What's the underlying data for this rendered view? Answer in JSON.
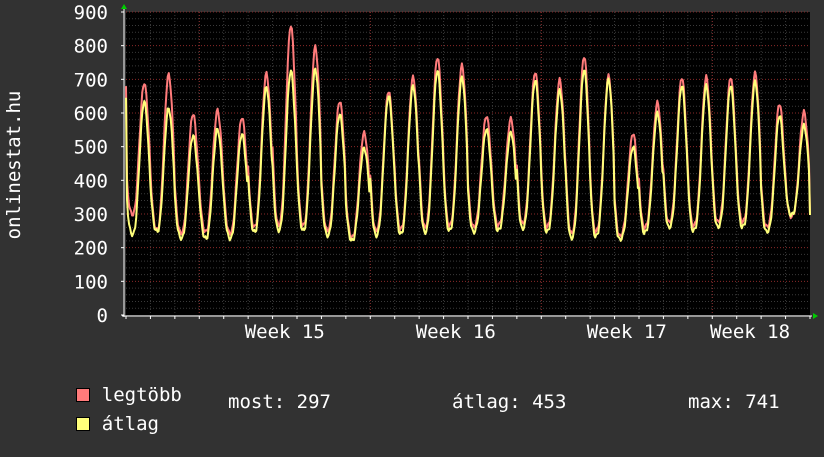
{
  "chart_data": {
    "type": "line",
    "ylabel": "onlinestat.hu",
    "ylim": [
      0,
      900
    ],
    "yticks": [
      0,
      100,
      200,
      300,
      400,
      500,
      600,
      700,
      800,
      900
    ],
    "xticks": [
      "Week 15",
      "Week 16",
      "Week 17",
      "Week 18"
    ],
    "grid": true,
    "days": 28,
    "series": [
      {
        "name": "legtöbb",
        "color": "#ff7b7b",
        "daily_peaks": [
          690,
          715,
          600,
          610,
          590,
          720,
          865,
          800,
          640,
          545,
          670,
          710,
          770,
          745,
          595,
          585,
          725,
          700,
          770,
          710,
          540,
          630,
          705,
          705,
          705,
          715,
          625,
          600
        ],
        "daily_lows": [
          300,
          255,
          245,
          250,
          245,
          265,
          270,
          270,
          255,
          235,
          255,
          260,
          265,
          270,
          265,
          270,
          275,
          265,
          245,
          250,
          235,
          260,
          275,
          265,
          275,
          275,
          260,
          290
        ]
      },
      {
        "name": "átlag",
        "color": "#ffff7b",
        "daily_peaks": [
          635,
          615,
          535,
          555,
          540,
          680,
          730,
          735,
          600,
          500,
          655,
          685,
          730,
          710,
          555,
          545,
          700,
          670,
          730,
          700,
          500,
          600,
          680,
          680,
          680,
          690,
          590,
          560
        ],
        "daily_lows": [
          240,
          250,
          230,
          230,
          230,
          250,
          255,
          255,
          240,
          225,
          240,
          245,
          250,
          255,
          250,
          255,
          260,
          250,
          230,
          235,
          225,
          245,
          260,
          250,
          260,
          260,
          245,
          295
        ]
      }
    ]
  },
  "legend": {
    "max_label": "legtöbb",
    "avg_label": "átlag",
    "now": "most: 297",
    "average": "átlag: 453",
    "max": "max: 741"
  }
}
